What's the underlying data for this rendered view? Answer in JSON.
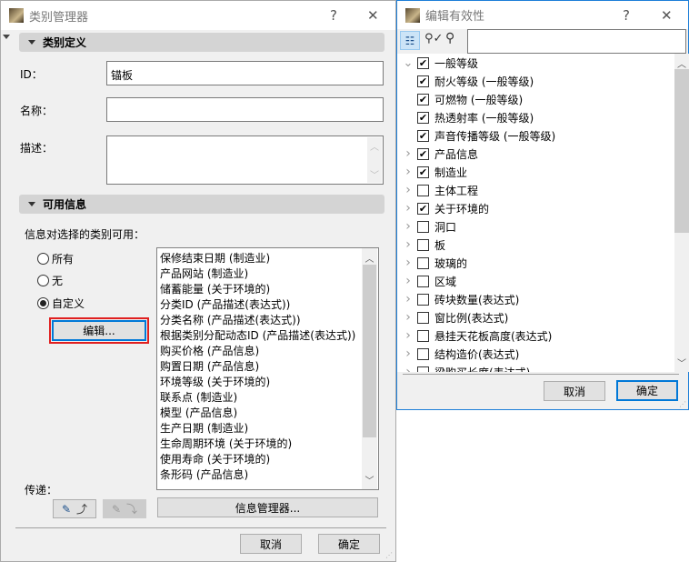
{
  "left_dialog": {
    "title": "类别管理器",
    "help": "?",
    "close": "✕",
    "section1": "类别定义",
    "id_label": "ID：",
    "id_value": "锚板",
    "name_label": "名称：",
    "name_value": "",
    "desc_label": "描述：",
    "desc_value": "",
    "section2": "可用信息",
    "avail_label": "信息对选择的类别可用：",
    "radios": [
      {
        "label": "所有",
        "selected": false
      },
      {
        "label": "无",
        "selected": false
      },
      {
        "label": "自定义",
        "selected": true
      }
    ],
    "edit_button": "编辑...",
    "info_list": [
      "保修结束日期 (制造业)",
      "产品网站 (制造业)",
      "储蓄能量 (关于环境的)",
      "分类ID (产品描述(表达式))",
      "分类名称 (产品描述(表达式))",
      "根据类别分配动态ID (产品描述(表达式))",
      "购买价格 (产品信息)",
      "购置日期 (产品信息)",
      "环境等级 (关于环境的)",
      "联系点 (制造业)",
      "模型 (产品信息)",
      "生产日期 (制造业)",
      "生命周期环境 (关于环境的)",
      "使用寿命 (关于环境的)",
      "条形码 (产品信息)"
    ],
    "transfer_label": "传递：",
    "info_manager_button": "信息管理器...",
    "cancel": "取消",
    "ok": "确定"
  },
  "right_dialog": {
    "title": "编辑有效性",
    "help": "?",
    "close": "✕",
    "search_value": "",
    "tree": [
      {
        "label": "一般等级",
        "level": 0,
        "checked": true,
        "expanded": true
      },
      {
        "label": "耐火等级 (一般等级)",
        "level": 1,
        "checked": true
      },
      {
        "label": "可燃物 (一般等级)",
        "level": 1,
        "checked": true
      },
      {
        "label": "热透射率 (一般等级)",
        "level": 1,
        "checked": true
      },
      {
        "label": "声音传播等级 (一般等级)",
        "level": 1,
        "checked": true
      },
      {
        "label": "产品信息",
        "level": 0,
        "checked": true,
        "expanded": false
      },
      {
        "label": "制造业",
        "level": 0,
        "checked": true,
        "expanded": false
      },
      {
        "label": "主体工程",
        "level": 0,
        "checked": false,
        "expanded": false
      },
      {
        "label": "关于环境的",
        "level": 0,
        "checked": true,
        "expanded": false
      },
      {
        "label": "洞口",
        "level": 0,
        "checked": false,
        "expanded": false
      },
      {
        "label": "板",
        "level": 0,
        "checked": false,
        "expanded": false
      },
      {
        "label": "玻璃的",
        "level": 0,
        "checked": false,
        "expanded": false
      },
      {
        "label": "区域",
        "level": 0,
        "checked": false,
        "expanded": false
      },
      {
        "label": "砖块数量(表达式)",
        "level": 0,
        "checked": false,
        "expanded": false
      },
      {
        "label": "窗比例(表达式)",
        "level": 0,
        "checked": false,
        "expanded": false
      },
      {
        "label": "悬挂天花板高度(表达式)",
        "level": 0,
        "checked": false,
        "expanded": false
      },
      {
        "label": "结构造价(表达式)",
        "level": 0,
        "checked": false,
        "expanded": false
      },
      {
        "label": "梁购买长度(表达式)",
        "level": 0,
        "checked": false,
        "expanded": false
      }
    ],
    "cancel": "取消",
    "ok": "确定"
  }
}
